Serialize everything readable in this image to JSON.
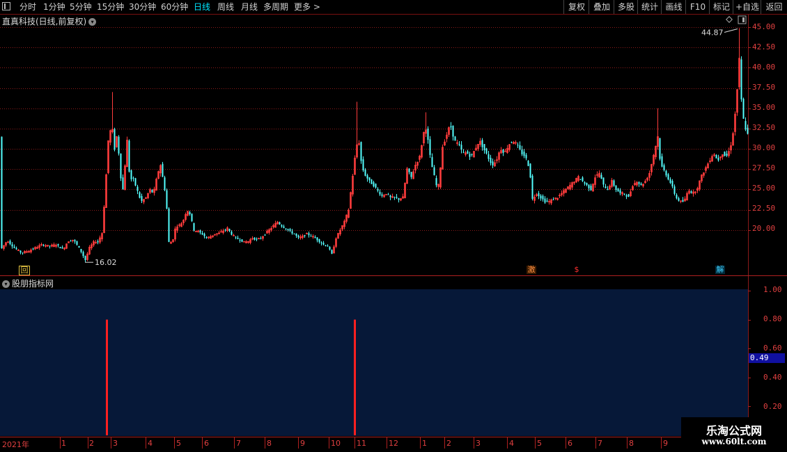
{
  "toolbar": {
    "periods": [
      "分时",
      "1分钟",
      "5分钟",
      "15分钟",
      "30分钟",
      "60分钟",
      "日线",
      "周线",
      "月线",
      "多周期",
      "更多 >"
    ],
    "active_period": "日线",
    "actions": [
      "复权",
      "叠加",
      "多股",
      "统计",
      "画线",
      "F10",
      "标记",
      "+自选",
      "返回"
    ]
  },
  "chart": {
    "title": "直真科技(日线,前复权)",
    "y_ticks": [
      "45.00",
      "42.50",
      "40.00",
      "37.50",
      "35.00",
      "32.50",
      "30.00",
      "27.50",
      "25.00",
      "22.50",
      "20.00"
    ],
    "max_label": "44.87",
    "min_label": "16.02",
    "markers": [
      {
        "text": "回",
        "color": "#e0c040"
      },
      {
        "text": "激",
        "color": "#ff9040"
      },
      {
        "text": "$",
        "color": "#ff3030"
      },
      {
        "text": "解",
        "color": "#40d0ff"
      }
    ]
  },
  "indicator": {
    "title": "股朋指标网",
    "y_ticks": [
      "1.00",
      "0.80",
      "0.60",
      "0.40",
      "0.20"
    ],
    "current_value": "0.49"
  },
  "x_axis": {
    "labels": [
      "2021年",
      "1",
      "2",
      "3",
      "4",
      "5",
      "6",
      "7",
      "8",
      "9",
      "10",
      "11",
      "12",
      "1",
      "2",
      "3",
      "4",
      "5",
      "6",
      "7",
      "8",
      "9"
    ]
  },
  "watermark": {
    "line1": "乐淘公式网",
    "line2": "www.60lt.com"
  },
  "colors": {
    "up": "#ff3c3c",
    "down": "#54ffff",
    "grid": "#8b1a1a",
    "panel": "#061838",
    "signal": "#ff2020"
  },
  "chart_data": {
    "type": "candlestick",
    "title": "直真科技(日线,前复权)",
    "ylim": [
      15.5,
      46.5
    ],
    "y_ticks": [
      20.0,
      22.5,
      25.0,
      27.5,
      30.0,
      32.5,
      35.0,
      37.5,
      40.0,
      42.5,
      45.0
    ],
    "anchors": [
      [
        0,
        17.5
      ],
      [
        10,
        18.7
      ],
      [
        20,
        17.8
      ],
      [
        30,
        17.2
      ],
      [
        40,
        17.4
      ],
      [
        50,
        17.8
      ],
      [
        60,
        18.2
      ],
      [
        70,
        18.0
      ],
      [
        80,
        18.2
      ],
      [
        90,
        17.6
      ],
      [
        97,
        18.6
      ],
      [
        105,
        18.8
      ],
      [
        115,
        17.5
      ],
      [
        122,
        16.3
      ],
      [
        128,
        17.8
      ],
      [
        135,
        18.6
      ],
      [
        140,
        18.5
      ],
      [
        146,
        19.6
      ],
      [
        150,
        24.0
      ],
      [
        155,
        31.0
      ],
      [
        160,
        33.0
      ],
      [
        164,
        30.0
      ],
      [
        168,
        32.0
      ],
      [
        172,
        27.0
      ],
      [
        176,
        25.0
      ],
      [
        182,
        31.0
      ],
      [
        186,
        26.0
      ],
      [
        190,
        26.5
      ],
      [
        196,
        25.0
      ],
      [
        202,
        23.5
      ],
      [
        210,
        24.0
      ],
      [
        214,
        25.0
      ],
      [
        220,
        24.5
      ],
      [
        226,
        27.0
      ],
      [
        230,
        28.0
      ],
      [
        234,
        26.0
      ],
      [
        238,
        24.0
      ],
      [
        242,
        18.5
      ],
      [
        247,
        18.5
      ],
      [
        252,
        20.5
      ],
      [
        256,
        20.5
      ],
      [
        262,
        21.0
      ],
      [
        268,
        22.5
      ],
      [
        272,
        22.0
      ],
      [
        278,
        20.0
      ],
      [
        284,
        19.8
      ],
      [
        290,
        19.5
      ],
      [
        296,
        19.0
      ],
      [
        302,
        19.2
      ],
      [
        308,
        19.5
      ],
      [
        314,
        19.6
      ],
      [
        320,
        19.9
      ],
      [
        326,
        20.2
      ],
      [
        332,
        19.5
      ],
      [
        338,
        19.0
      ],
      [
        344,
        18.8
      ],
      [
        350,
        18.5
      ],
      [
        356,
        18.6
      ],
      [
        362,
        19.0
      ],
      [
        368,
        18.8
      ],
      [
        374,
        19.0
      ],
      [
        380,
        19.5
      ],
      [
        386,
        20.0
      ],
      [
        392,
        20.5
      ],
      [
        398,
        21.0
      ],
      [
        404,
        20.5
      ],
      [
        410,
        20.2
      ],
      [
        416,
        19.8
      ],
      [
        422,
        19.5
      ],
      [
        428,
        19.0
      ],
      [
        434,
        19.2
      ],
      [
        440,
        19.5
      ],
      [
        446,
        19.3
      ],
      [
        452,
        19.0
      ],
      [
        458,
        18.6
      ],
      [
        464,
        18.2
      ],
      [
        470,
        18.0
      ],
      [
        476,
        17.0
      ],
      [
        482,
        19.0
      ],
      [
        488,
        20.0
      ],
      [
        494,
        21.0
      ],
      [
        500,
        22.5
      ],
      [
        505,
        26.0
      ],
      [
        510,
        29.5
      ],
      [
        514,
        31.5
      ],
      [
        518,
        28.5
      ],
      [
        522,
        27.0
      ],
      [
        526,
        26.5
      ],
      [
        530,
        26.0
      ],
      [
        536,
        25.5
      ],
      [
        542,
        24.8
      ],
      [
        548,
        24.2
      ],
      [
        554,
        24.5
      ],
      [
        560,
        24.0
      ],
      [
        566,
        24.0
      ],
      [
        572,
        23.8
      ],
      [
        578,
        24.0
      ],
      [
        584,
        27.5
      ],
      [
        590,
        26.5
      ],
      [
        596,
        28.0
      ],
      [
        602,
        29.0
      ],
      [
        606,
        31.0
      ],
      [
        610,
        33.0
      ],
      [
        614,
        31.0
      ],
      [
        618,
        28.5
      ],
      [
        622,
        27.0
      ],
      [
        626,
        25.5
      ],
      [
        630,
        25.5
      ],
      [
        634,
        30.0
      ],
      [
        640,
        31.5
      ],
      [
        646,
        33.0
      ],
      [
        652,
        31.0
      ],
      [
        658,
        30.5
      ],
      [
        664,
        29.5
      ],
      [
        670,
        29.5
      ],
      [
        676,
        29.0
      ],
      [
        682,
        30.0
      ],
      [
        688,
        31.0
      ],
      [
        694,
        30.0
      ],
      [
        700,
        29.0
      ],
      [
        706,
        28.0
      ],
      [
        712,
        28.5
      ],
      [
        718,
        30.0
      ],
      [
        724,
        29.5
      ],
      [
        730,
        30.5
      ],
      [
        736,
        31.0
      ],
      [
        742,
        30.5
      ],
      [
        748,
        29.5
      ],
      [
        754,
        29.0
      ],
      [
        760,
        27.5
      ],
      [
        764,
        23.8
      ],
      [
        770,
        24.5
      ],
      [
        776,
        24.0
      ],
      [
        782,
        23.5
      ],
      [
        788,
        23.5
      ],
      [
        794,
        23.8
      ],
      [
        800,
        24.0
      ],
      [
        806,
        24.5
      ],
      [
        812,
        25.0
      ],
      [
        818,
        25.5
      ],
      [
        824,
        26.0
      ],
      [
        830,
        26.5
      ],
      [
        836,
        26.0
      ],
      [
        842,
        25.5
      ],
      [
        848,
        25.0
      ],
      [
        854,
        26.5
      ],
      [
        860,
        27.0
      ],
      [
        866,
        25.5
      ],
      [
        872,
        25.0
      ],
      [
        878,
        26.0
      ],
      [
        884,
        25.0
      ],
      [
        890,
        24.5
      ],
      [
        896,
        24.5
      ],
      [
        902,
        24.0
      ],
      [
        908,
        25.5
      ],
      [
        914,
        26.0
      ],
      [
        920,
        25.5
      ],
      [
        926,
        26.0
      ],
      [
        932,
        27.0
      ],
      [
        936,
        28.5
      ],
      [
        940,
        30.0
      ],
      [
        944,
        31.5
      ],
      [
        948,
        28.0
      ],
      [
        952,
        27.5
      ],
      [
        958,
        26.5
      ],
      [
        964,
        25.5
      ],
      [
        970,
        24.0
      ],
      [
        976,
        23.5
      ],
      [
        982,
        23.5
      ],
      [
        988,
        25.0
      ],
      [
        994,
        24.5
      ],
      [
        1000,
        25.0
      ],
      [
        1006,
        26.5
      ],
      [
        1012,
        27.5
      ],
      [
        1018,
        28.5
      ],
      [
        1024,
        29.5
      ],
      [
        1030,
        28.5
      ],
      [
        1036,
        29.5
      ],
      [
        1042,
        29.0
      ],
      [
        1048,
        30.0
      ],
      [
        1052,
        32.0
      ],
      [
        1056,
        35.0
      ],
      [
        1059,
        38.5
      ],
      [
        1061,
        41.0
      ],
      [
        1063,
        37.0
      ],
      [
        1066,
        34.0
      ],
      [
        1070,
        32.5
      ],
      [
        1074,
        31.5
      ]
    ],
    "spikes": [
      {
        "x": 162,
        "high": 37.0
      },
      {
        "x": 513,
        "high": 35.8
      },
      {
        "x": 612,
        "high": 34.5
      },
      {
        "x": 945,
        "high": 35.0
      },
      {
        "x": 1061,
        "high": 44.87
      }
    ],
    "max": {
      "value": 44.87
    },
    "min": {
      "value": 16.02
    }
  },
  "indicator_data": {
    "type": "bar",
    "ylim": [
      0,
      1.05
    ],
    "signals": [
      {
        "value": 0.8
      },
      {
        "value": 0.8
      }
    ]
  }
}
